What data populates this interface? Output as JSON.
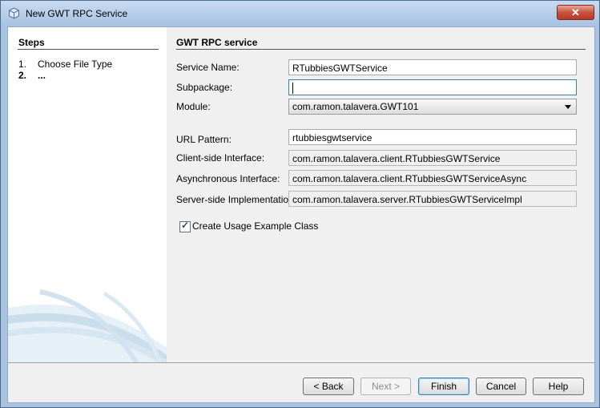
{
  "window": {
    "title": "New GWT RPC Service",
    "close_label": "✕"
  },
  "steps": {
    "title": "Steps",
    "items": [
      {
        "num": "1.",
        "label": "Choose File Type"
      },
      {
        "num": "2.",
        "label": "..."
      }
    ]
  },
  "content": {
    "title": "GWT RPC service",
    "service_name": {
      "label": "Service Name:",
      "value": "RTubbiesGWTService"
    },
    "subpackage": {
      "label": "Subpackage:",
      "value": ""
    },
    "module": {
      "label": "Module:",
      "value": "com.ramon.talavera.GWT101"
    },
    "url_pattern": {
      "label": "URL Pattern:",
      "value": "rtubbiesgwtservice"
    },
    "client_interface": {
      "label": "Client-side Interface:",
      "value": "com.ramon.talavera.client.RTubbiesGWTService"
    },
    "async_interface": {
      "label": "Asynchronous Interface:",
      "value": "com.ramon.talavera.client.RTubbiesGWTServiceAsync"
    },
    "server_impl": {
      "label": "Server-side Implementation:",
      "value": "com.ramon.talavera.server.RTubbiesGWTServiceImpl"
    },
    "usage_example": {
      "label": "Create Usage Example Class",
      "checked": true
    }
  },
  "buttons": {
    "back": "< Back",
    "next": "Next >",
    "finish": "Finish",
    "cancel": "Cancel",
    "help": "Help"
  }
}
